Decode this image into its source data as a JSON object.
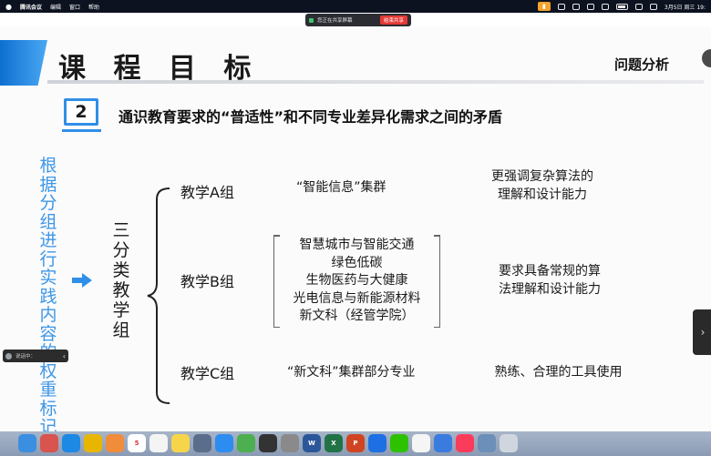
{
  "menubar": {
    "app_name": "腾讯会议",
    "menus": [
      "编辑",
      "窗口",
      "帮助"
    ],
    "date_time": "3月5日 周三 19:"
  },
  "share_banner": {
    "status_text": "您正在共享屏幕",
    "stop_label": "结束共享"
  },
  "slide": {
    "title": "课 程 目 标",
    "section_label": "问题分析",
    "number": "2",
    "heading": "通识教育要求的“普适性”和不同专业差异化需求之间的矛盾",
    "left_vertical": [
      "根",
      "据",
      "分",
      "组",
      "进",
      "行",
      "实",
      "践",
      "内",
      "容",
      "的",
      "权",
      "重",
      "标",
      "记"
    ],
    "center_vertical": [
      "三",
      "分",
      "类",
      "教",
      "学",
      "组"
    ],
    "groups": [
      {
        "name": "教学A组",
        "cluster": "“智能信息”集群",
        "description": [
          "更强调复杂算法的",
          "理解和设计能力"
        ]
      },
      {
        "name": "教学B组",
        "cluster_list": [
          "智慧城市与智能交通",
          "绿色低碳",
          "生物医药与大健康",
          "光电信息与新能源材料",
          "新文科（经管学院）"
        ],
        "description": [
          "要求具备常规的算",
          "法理解和设计能力"
        ]
      },
      {
        "name": "教学C组",
        "cluster": "“新文科”集群部分专业",
        "description": [
          "熟练、合理的工具使用"
        ]
      }
    ],
    "colors": {
      "accent_blue": "#2f8fe6",
      "vertical_blue": "#3d96e6"
    }
  },
  "floating_pill": {
    "text": "说话中："
  },
  "dock": {
    "apps": [
      {
        "icon": "finder-icon",
        "color": "#3b8fe0",
        "glyph": ""
      },
      {
        "icon": "launchpad-icon",
        "color": "#d9534f",
        "glyph": ""
      },
      {
        "icon": "safari-icon",
        "color": "#1e88e5",
        "glyph": ""
      },
      {
        "icon": "chrome-icon",
        "color": "#e8b600",
        "glyph": ""
      },
      {
        "icon": "photos-icon",
        "color": "#f08c3a",
        "glyph": ""
      },
      {
        "icon": "calendar-icon",
        "color": "#ffffff",
        "glyph": "5"
      },
      {
        "icon": "reminders-icon",
        "color": "#f4f4f4",
        "glyph": ""
      },
      {
        "icon": "notes-icon",
        "color": "#f7d54a",
        "glyph": ""
      },
      {
        "icon": "files-icon",
        "color": "#5a6d8a",
        "glyph": ""
      },
      {
        "icon": "appstore-icon",
        "color": "#2d8cf0",
        "glyph": ""
      },
      {
        "icon": "maps-icon",
        "color": "#4caf50",
        "glyph": ""
      },
      {
        "icon": "calculator-icon",
        "color": "#333333",
        "glyph": ""
      },
      {
        "icon": "settings-icon",
        "color": "#8a8a8a",
        "glyph": ""
      },
      {
        "icon": "word-icon",
        "color": "#2b579a",
        "glyph": "W"
      },
      {
        "icon": "excel-icon",
        "color": "#217346",
        "glyph": "X"
      },
      {
        "icon": "powerpoint-icon",
        "color": "#d04423",
        "glyph": "P"
      },
      {
        "icon": "meeting-icon",
        "color": "#1e6fe3",
        "glyph": ""
      },
      {
        "icon": "wechat-icon",
        "color": "#2dc100",
        "glyph": ""
      },
      {
        "icon": "qq-icon",
        "color": "#f5f5f5",
        "glyph": ""
      },
      {
        "icon": "mail-icon",
        "color": "#3a7be0",
        "glyph": ""
      },
      {
        "icon": "music-icon",
        "color": "#fa3c5a",
        "glyph": ""
      },
      {
        "icon": "preview-icon",
        "color": "#6b8fb8",
        "glyph": ""
      },
      {
        "icon": "trash-icon",
        "color": "#cfd6de",
        "glyph": ""
      }
    ]
  }
}
